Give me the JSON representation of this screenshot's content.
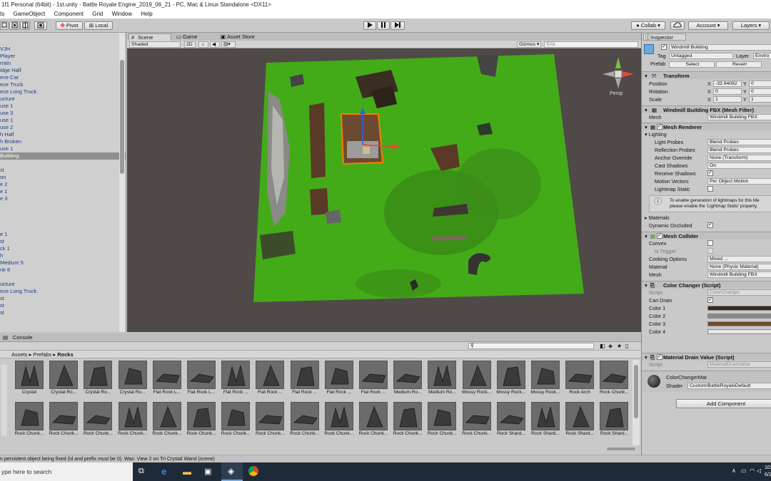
{
  "window_title": "1f1 Personal (64bit) - 1st.unity - Battle Royale Engine_2019_06_21 - PC, Mac & Linux Standalone <DX11>",
  "menu": [
    "ts",
    "GameObject",
    "Component",
    "Grid",
    "Window",
    "Help"
  ],
  "toolbar": {
    "pivot": "Pivot",
    "local": "Local",
    "collab": "Collab",
    "account": "Account",
    "layers": "Layers"
  },
  "hierarchy": {
    "items": [
      "VJH",
      "Player",
      "rrain",
      "idge Half",
      "ece Car",
      "ece Truck",
      "ece Long Truck",
      "ucture",
      "use 1",
      "use 3",
      "use 1",
      "use 2",
      "h Half",
      "h Broken",
      "use 1",
      "Building",
      "",
      "st",
      "on",
      "e 2",
      "e 1",
      "e 3",
      "",
      "",
      "",
      "",
      "e 1",
      "st",
      "ck 1",
      "h",
      "Medium 5",
      "nk 8",
      "",
      "ucture",
      "ece Long Truck",
      "st",
      "st",
      "st"
    ],
    "selected_index": 15
  },
  "scene": {
    "tabs": [
      "Scene",
      "Game",
      "Asset Store"
    ],
    "shading": "Shaded",
    "mode_2d": "2D",
    "gizmos": "Gizmos",
    "search_placeholder": "All",
    "persp": "Persp"
  },
  "console_tab": "Console",
  "project": {
    "breadcrumb": [
      "Assets",
      "Prefabs",
      "Rocks"
    ],
    "assets_row1": [
      "Crystal",
      "Crystal Ro...",
      "Crystal Ro...",
      "Crystal Ro...",
      "Flat Rock L...",
      "Flat Rock L...",
      "Flat Rock ...",
      "Flat Rock ...",
      "Flat Rock ...",
      "Flat Rock ...",
      "Flat Rock ...",
      "Medium Ro...",
      "Medium Ro...",
      "Mossy Rock...",
      "Mossy Rock...",
      "Mossy Rock...",
      "Rock Arch",
      "Rock Chunk..."
    ],
    "assets_row2": [
      "Rock Chunk...",
      "Rock Chunk...",
      "Rock Chunk...",
      "Rock Chunk...",
      "Rock Chunk...",
      "Rock Chunk...",
      "Rock Chunk...",
      "Rock Chunk...",
      "Rock Chunk...",
      "Rock Chunk...",
      "Rock Chunk...",
      "Rock Chunk...",
      "Rock Chunk...",
      "Rock Chunk...",
      "Rock Shard...",
      "Rock Shard...",
      "Rock Shard...",
      "Rock Shard..."
    ]
  },
  "status_message": "n persistent object being fixed (id and prefix must be 0). Was: View 2 on Tri Crystal Wand (scene)",
  "taskbar": {
    "search_placeholder": "ype here to search",
    "clock_time": "10:",
    "clock_date": "6/2"
  },
  "inspector": {
    "tab": "Inspector",
    "object_name": "Windmill Building",
    "tag_label": "Tag",
    "tag_value": "Untagged",
    "layer_label": "Layer",
    "layer_value": "Enviro",
    "prefab_label": "Prefab",
    "prefab_select": "Select",
    "prefab_revert": "Revert",
    "transform": {
      "title": "Transform",
      "position_label": "Position",
      "rotation_label": "Rotation",
      "scale_label": "Scale",
      "position": [
        "-33.94092",
        "0"
      ],
      "rotation": [
        "0",
        "0"
      ],
      "scale": [
        "1",
        "1"
      ]
    },
    "mesh_filter": {
      "title": "Windmill Building FBX (Mesh Filter)",
      "mesh_label": "Mesh",
      "mesh_value": "Windmill Building FBX"
    },
    "mesh_renderer": {
      "title": "Mesh Renderer",
      "lighting": "Lighting",
      "rows": [
        {
          "label": "Light Probes",
          "value": "Blend Probes"
        },
        {
          "label": "Reflection Probes",
          "value": "Blend Probes"
        },
        {
          "label": "Anchor Override",
          "value": "None (Transform)"
        },
        {
          "label": "Cast Shadows",
          "value": "On"
        },
        {
          "label": "Receive Shadows",
          "value": ""
        },
        {
          "label": "Motion Vectors",
          "value": "Per Object Motion"
        },
        {
          "label": "Lightmap Static",
          "value": ""
        }
      ],
      "info": [
        "To enable generation of lightmaps for this Me",
        "please enable the 'Lightmap Static' property."
      ],
      "materials": "Materials",
      "dynamic_occluded": "Dynamic Occluded"
    },
    "mesh_collider": {
      "title": "Mesh Collider",
      "convex": "Convex",
      "is_trigger": "Is Trigger",
      "cooking_label": "Cooking Options",
      "cooking_value": "Mixed ...",
      "material_label": "Material",
      "material_value": "None (Physic Material)",
      "mesh_label": "Mesh",
      "mesh_value": "Windmill Building FBX"
    },
    "color_changer": {
      "title": "Color Changer (Script)",
      "script_label": "Script",
      "script_value": "ColorChanger",
      "can_drain": "Can Drain",
      "colors": [
        {
          "label": "Color 1",
          "hex": "#3d2a1a"
        },
        {
          "label": "Color 2",
          "hex": "#8a8a8a"
        },
        {
          "label": "Color 3",
          "hex": "#6b4a2a"
        },
        {
          "label": "Color 4",
          "hex": "#e6e6e6"
        }
      ]
    },
    "material_drain": {
      "title": "Material Drain Value (Script)",
      "script_label": "Script",
      "script_value": "MaterialDrainValue"
    },
    "material": {
      "name": "ColorChangerMat",
      "shader_label": "Shader",
      "shader_value": "Custom/BattleRoyaleDefault"
    },
    "add_component": "Add Component"
  }
}
